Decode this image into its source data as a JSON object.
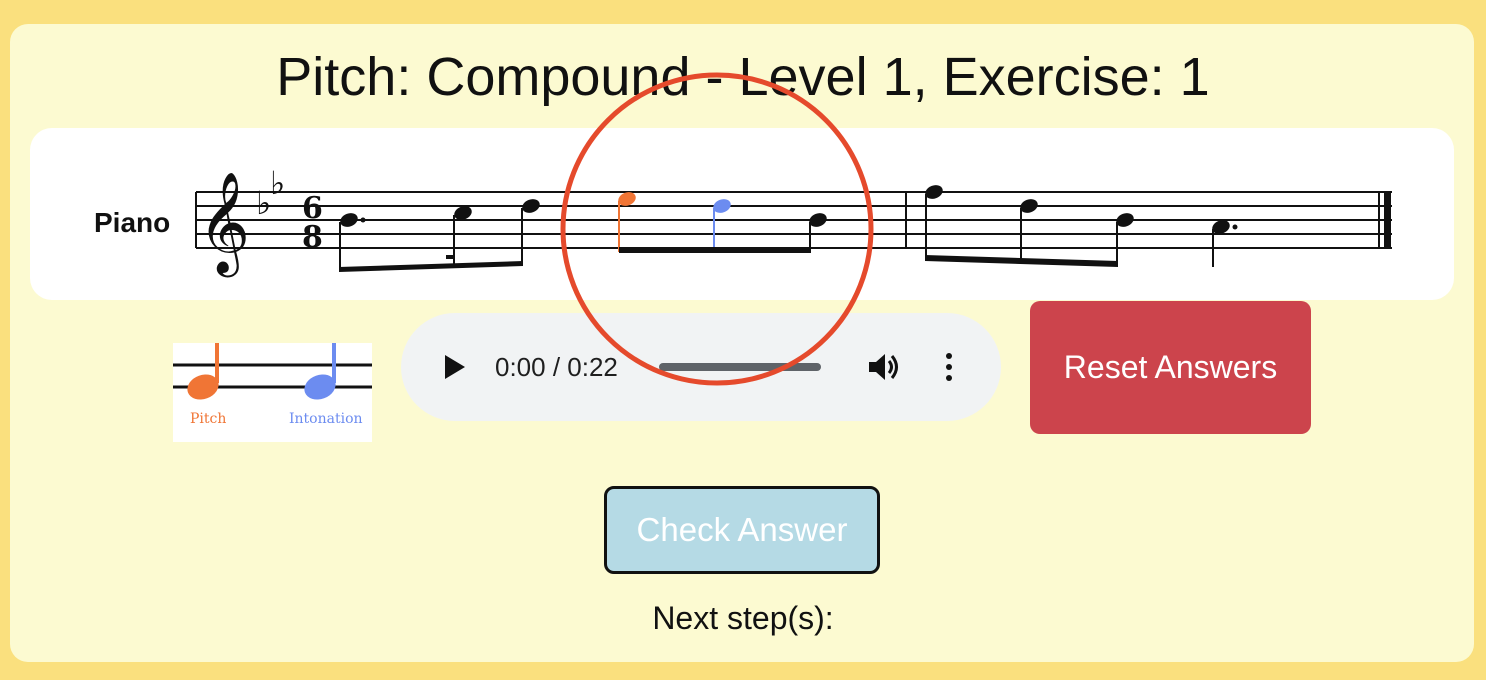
{
  "title": "Pitch: Compound - Level 1, Exercise: 1",
  "score": {
    "instrument_label": "Piano",
    "time_signature_top": "6",
    "time_signature_bottom": "8"
  },
  "legend": {
    "pitch_label": "Pitch",
    "intonation_label": "Intonation"
  },
  "audio": {
    "time_display": "0:00 / 0:22",
    "progress": 0
  },
  "buttons": {
    "reset_label": "Reset Answers",
    "check_label": "Check Answer"
  },
  "next_steps_label": "Next step(s):",
  "colors": {
    "page_background": "#fae07e",
    "panel_background": "#fcfad1",
    "pitch_color": "#f07535",
    "intonation_color": "#6c8cf0",
    "reset_button": "#cc444c",
    "check_button": "#b5dae5",
    "highlight_ring": "#e54a2c"
  }
}
